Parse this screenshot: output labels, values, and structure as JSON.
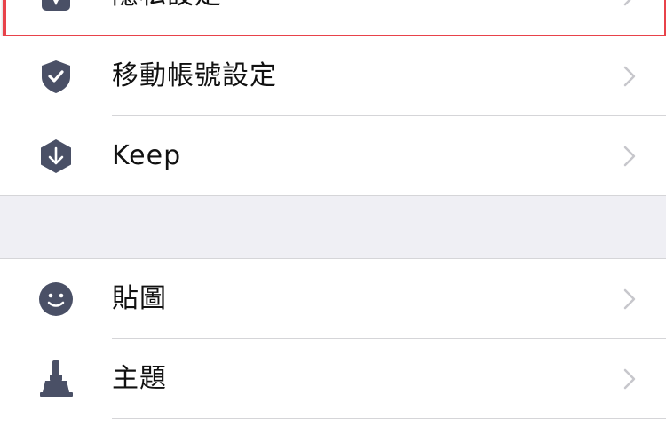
{
  "settings": {
    "items": [
      {
        "label": "隱私設定",
        "icon": "lock-icon"
      },
      {
        "label": "移動帳號設定",
        "icon": "shield-check-icon"
      },
      {
        "label": "Keep",
        "icon": "keep-icon"
      }
    ],
    "items2": [
      {
        "label": "貼圖",
        "icon": "smiley-icon"
      },
      {
        "label": "主題",
        "icon": "paint-brush-icon"
      }
    ]
  },
  "colors": {
    "icon": "#4a5066",
    "chevron": "#c7c7cc",
    "highlight": "#e8424a",
    "section_gap": "#efeff4",
    "separator": "#d5d5d8"
  }
}
